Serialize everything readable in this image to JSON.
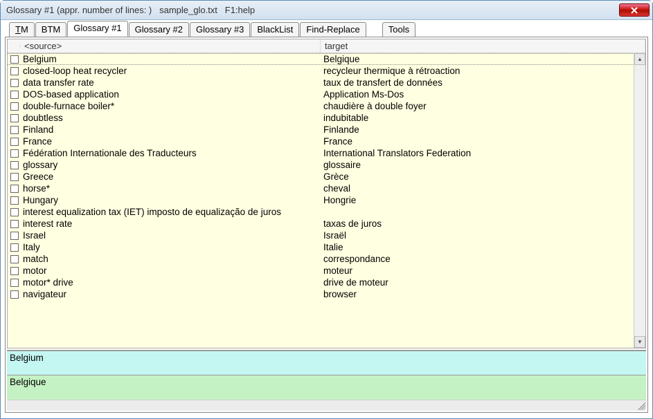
{
  "window": {
    "title": "Glossary #1 (appr. number of lines: )   sample_glo.txt   F1:help"
  },
  "tabs": [
    {
      "label": "TM",
      "active": false,
      "u": true
    },
    {
      "label": "BTM",
      "active": false
    },
    {
      "label": "Glossary #1",
      "active": true
    },
    {
      "label": "Glossary #2",
      "active": false
    },
    {
      "label": "Glossary #3",
      "active": false
    },
    {
      "label": "BlackList",
      "active": false
    },
    {
      "label": "Find-Replace",
      "active": false
    },
    {
      "label": "Tools",
      "active": false,
      "spacer_before": true
    }
  ],
  "headers": {
    "source": "<source>",
    "target": "target"
  },
  "rows": [
    {
      "source": "Belgium",
      "target": "Belgique",
      "selected": true
    },
    {
      "source": "closed-loop heat recycler",
      "target": "recycleur thermique à rétroaction"
    },
    {
      "source": "data transfer rate",
      "target": "taux de transfert de données"
    },
    {
      "source": "DOS-based application",
      "target": "Application Ms-Dos"
    },
    {
      "source": "double-furnace boiler*",
      "target": "chaudière à double foyer"
    },
    {
      "source": "doubtless",
      "target": "indubitable"
    },
    {
      "source": "Finland",
      "target": "Finlande"
    },
    {
      "source": "France",
      "target": "France"
    },
    {
      "source": "Fédération Internationale des Traducteurs",
      "target": "International Translators Federation"
    },
    {
      "source": "glossary",
      "target": "glossaire"
    },
    {
      "source": "Greece",
      "target": "Grèce"
    },
    {
      "source": "horse*",
      "target": "cheval"
    },
    {
      "source": "Hungary",
      "target": "Hongrie"
    },
    {
      "source": "interest equalization tax (IET) imposto de equalização de juros",
      "target": ""
    },
    {
      "source": "interest rate",
      "target": "taxas de juros"
    },
    {
      "source": "Israel",
      "target": "Israël"
    },
    {
      "source": "Italy",
      "target": "Italie"
    },
    {
      "source": "match",
      "target": "correspondance"
    },
    {
      "source": "motor",
      "target": "moteur"
    },
    {
      "source": "motor* drive",
      "target": "drive de moteur"
    },
    {
      "source": "navigateur",
      "target": "browser"
    }
  ],
  "entry": {
    "source": "Belgium",
    "target": "Belgique"
  }
}
